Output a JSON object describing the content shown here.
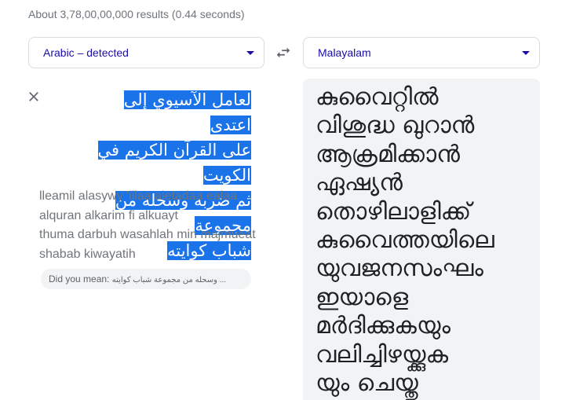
{
  "results_stats": "About 3,78,00,00,000 results (0.44 seconds)",
  "source_language": "Arabic – detected",
  "target_language": "Malayalam",
  "icons": {
    "swap": "swap-horiz-icon",
    "clear": "close-icon",
    "dropdown": "caret-down-icon"
  },
  "colors": {
    "link_blue": "#1a0dab",
    "selection_blue": "#1a73e8",
    "panel_grey": "#f1f3f4"
  },
  "source_lines": [
    "لعامل الآسيوي إلى اعتدى",
    "على القرآن الكريم في الكويت",
    "ثم ضربه وسحله من مجموعة",
    "شباب كوايته"
  ],
  "transliteration_lines": [
    "lleamil alasywy 'iilaa aietadaa ealaa",
    "alquran alkarim fi alkuayt",
    "thuma darbuh wasahlah min majmueat",
    "shabab kiwayatih"
  ],
  "did_you_mean": {
    "label": "Did you mean:",
    "suggestion": "... وسحله من مجموعة شباب كوايته"
  },
  "translation_lines": [
    "കുവൈറ്റിൽ",
    "വിശുദ്ധ ഖുറാൻ",
    "ആക്രമിക്കാൻ",
    "ഏഷ്യൻ",
    "തൊഴിലാളിക്ക്",
    "കുവൈത്തയിലെ",
    "യുവജനസംഘം",
    "ഇയാളെ",
    "മർദിക്കുകയും",
    "വലിച്ചിഴയ്ക്കുക",
    "യും ചെയ്തു"
  ]
}
